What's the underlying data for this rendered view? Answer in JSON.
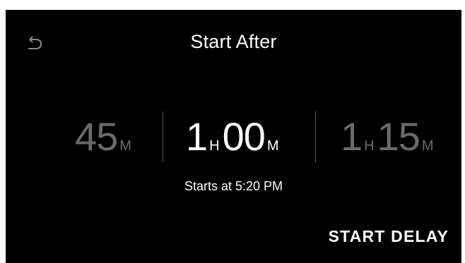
{
  "header": {
    "back_icon": "back-arrow-icon",
    "title": "Start After"
  },
  "picker": {
    "options": [
      {
        "value": "45",
        "unit": "M"
      },
      {
        "hours": "1",
        "hours_unit": "H",
        "minutes": "00",
        "minutes_unit": "M",
        "selected": true
      },
      {
        "hours": "1",
        "hours_unit": "H",
        "minutes": "15",
        "minutes_unit": "M"
      }
    ]
  },
  "status": {
    "starts_text": "Starts at 5:20 PM"
  },
  "actions": {
    "start_delay_label": "START DELAY"
  },
  "colors": {
    "background": "#000000",
    "text": "#ffffff",
    "dim_text": "#6b6b6b",
    "divider": "#5a5a5a"
  }
}
